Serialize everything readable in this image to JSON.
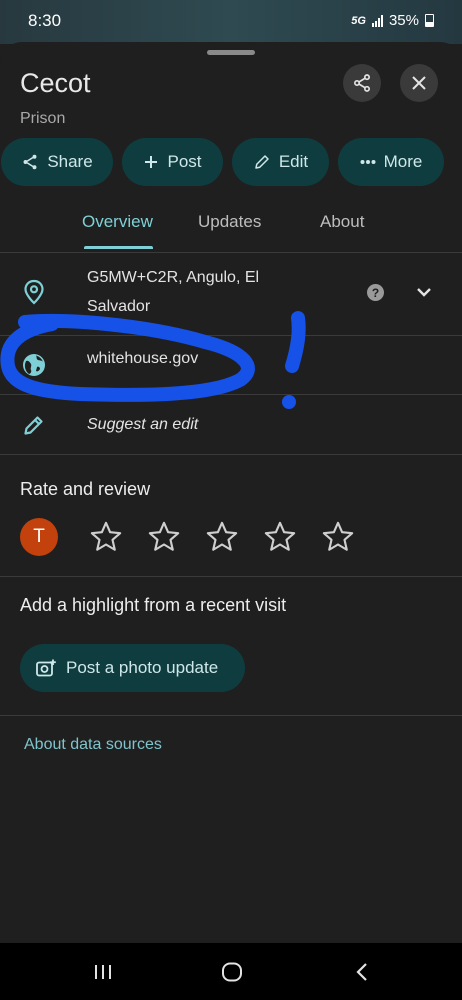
{
  "status_bar": {
    "time": "8:30",
    "network": "5G",
    "battery": "35%"
  },
  "place": {
    "name": "Cecot",
    "category": "Prison"
  },
  "header_buttons": {
    "share_icon": "share-icon",
    "close_icon": "close-icon"
  },
  "actions": [
    {
      "label": "Share",
      "icon": "share-icon"
    },
    {
      "label": "Post",
      "icon": "plus-icon"
    },
    {
      "label": "Edit",
      "icon": "pencil-icon"
    },
    {
      "label": "More",
      "icon": "dots-icon"
    }
  ],
  "tabs": [
    {
      "label": "Overview",
      "active": true
    },
    {
      "label": "Updates",
      "active": false
    },
    {
      "label": "About",
      "active": false
    }
  ],
  "details": {
    "address_line1": "G5MW+C2R, Angulo, El",
    "address_line2": "Salvador",
    "website": "whitehouse.gov",
    "suggest_edit": "Suggest an edit"
  },
  "rate_review": {
    "title": "Rate and review",
    "avatar_initial": "T",
    "stars": 5
  },
  "highlight": {
    "title": "Add a highlight from a recent visit",
    "post_button": "Post a photo update"
  },
  "footer_link": "About data sources",
  "colors": {
    "accent": "#7fd0d6",
    "chip_bg": "#0f3d3f",
    "annotation": "#1652e8",
    "avatar": "#c2410c"
  }
}
